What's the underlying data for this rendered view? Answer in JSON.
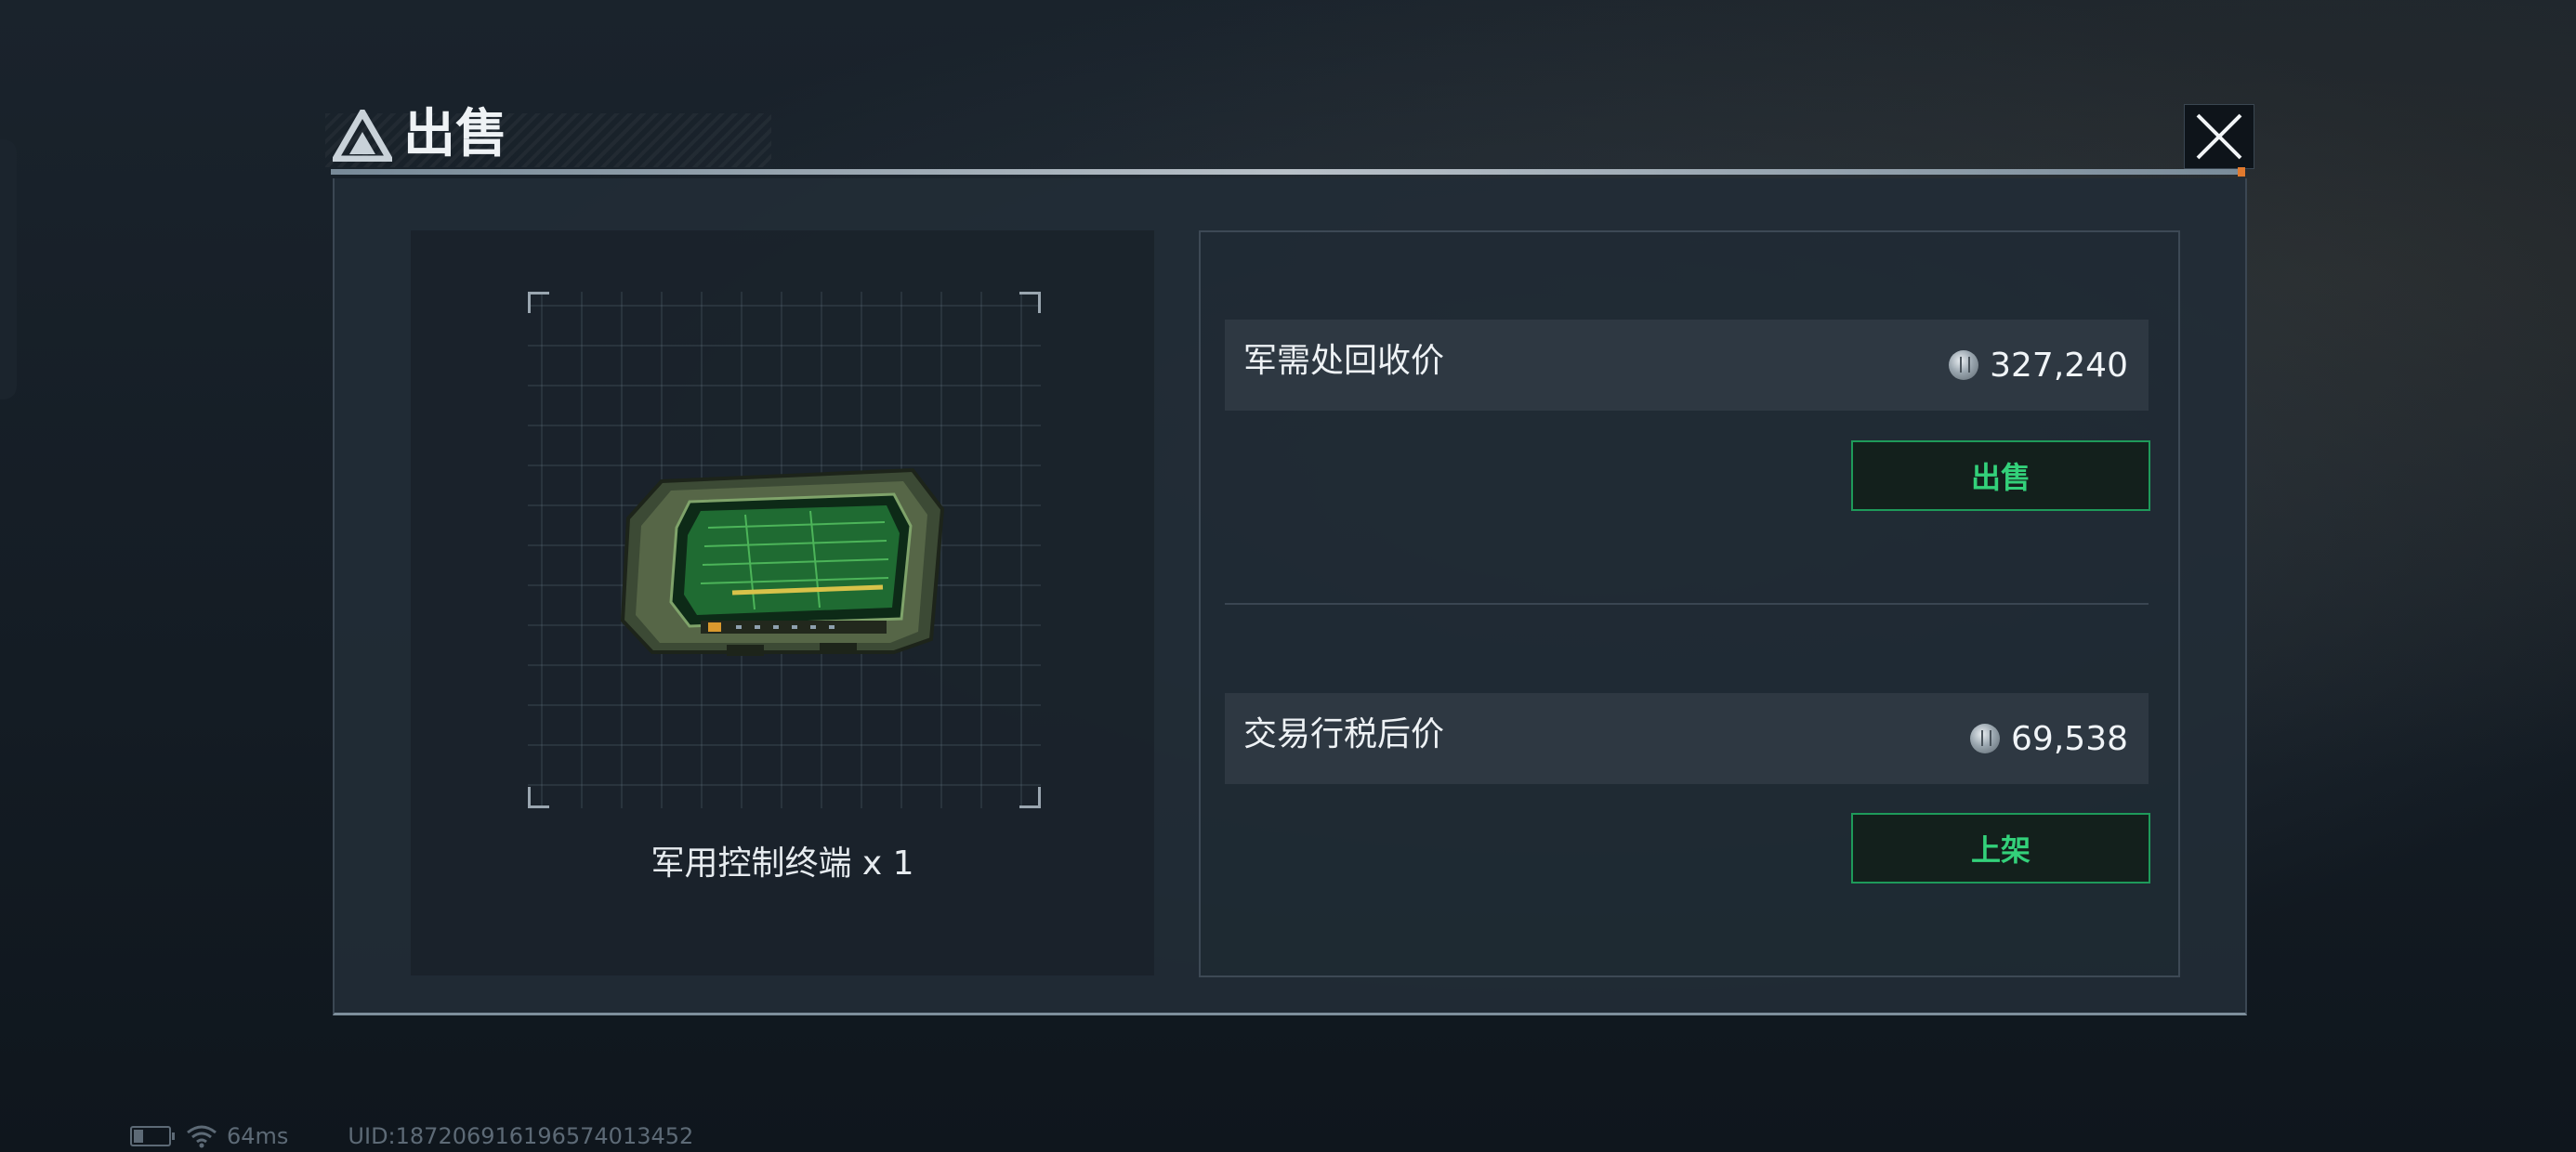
{
  "dialog": {
    "title": "出售",
    "close_icon": "close-icon"
  },
  "item": {
    "name": "军用控制终端 x 1",
    "image_icon": "military-control-terminal-tablet"
  },
  "prices": {
    "recycle": {
      "label": "军需处回收价",
      "value": "327,240",
      "currency_icon": "coin-icon",
      "button_label": "出售"
    },
    "market": {
      "label": "交易行税后价",
      "value": "69,538",
      "currency_icon": "coin-icon",
      "button_label": "上架"
    }
  },
  "status": {
    "ping": "64ms",
    "uid": "UID:18720691619657401345​2"
  },
  "colors": {
    "accent_green": "#33d17a",
    "button_border": "#1e9a5a",
    "panel_bg": "#222c36"
  }
}
